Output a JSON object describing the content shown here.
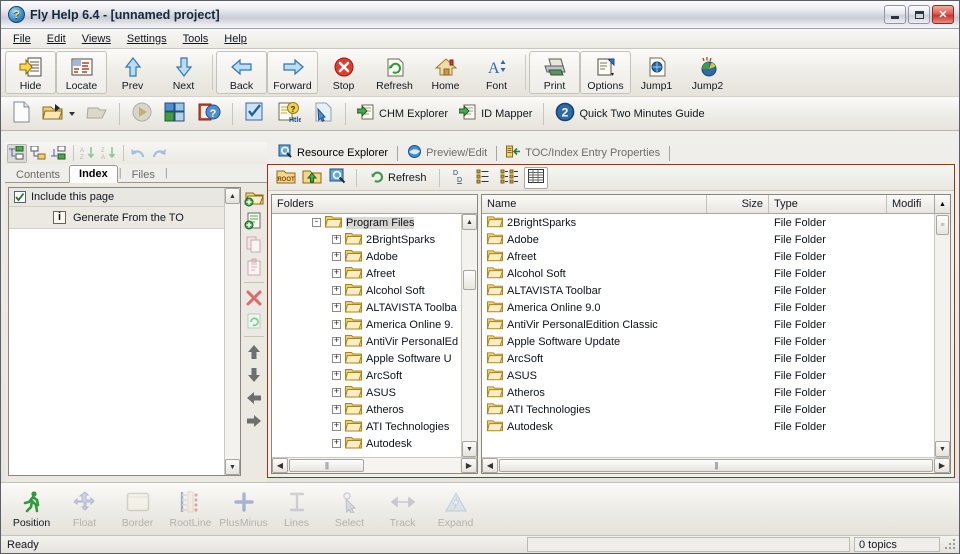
{
  "window": {
    "title": "Fly Help 6.4 - [unnamed project]",
    "icon": "help-question-icon",
    "buttons": {
      "minimize": "minimize-button",
      "maximize": "maximize-button",
      "close": "close-button"
    }
  },
  "menu": {
    "items": [
      "File",
      "Edit",
      "Views",
      "Settings",
      "Tools",
      "Help"
    ]
  },
  "toolbar_main": {
    "buttons": [
      {
        "label": "Hide",
        "icon": "hide-panel-icon",
        "framed": true
      },
      {
        "label": "Locate",
        "icon": "locate-icon",
        "framed": true
      },
      {
        "label": "Prev",
        "icon": "arrow-up-icon",
        "framed": false
      },
      {
        "label": "Next",
        "icon": "arrow-down-icon",
        "framed": false
      },
      {
        "label": "Back",
        "icon": "arrow-left-icon",
        "framed": true
      },
      {
        "label": "Forward",
        "icon": "arrow-right-icon",
        "framed": true
      },
      {
        "label": "Stop",
        "icon": "stop-icon",
        "framed": false
      },
      {
        "label": "Refresh",
        "icon": "refresh-icon",
        "framed": false
      },
      {
        "label": "Home",
        "icon": "home-icon",
        "framed": false
      },
      {
        "label": "Font",
        "icon": "font-size-icon",
        "framed": false
      },
      {
        "label": "Print",
        "icon": "printer-icon",
        "framed": true
      },
      {
        "label": "Options",
        "icon": "options-icon",
        "framed": true
      },
      {
        "label": "Jump1",
        "icon": "jump1-icon",
        "framed": false
      },
      {
        "label": "Jump2",
        "icon": "jump2-icon",
        "framed": false
      }
    ]
  },
  "toolbar_secondary": {
    "buttons": [
      {
        "label": "",
        "icon": "new-document-icon"
      },
      {
        "label": "",
        "icon": "open-folder-icon",
        "dropdown": true
      },
      {
        "label": "",
        "icon": "save-icon"
      },
      {
        "label": "",
        "icon": "compile-run-icon"
      },
      {
        "label": "",
        "icon": "layout-icon"
      },
      {
        "label": "",
        "icon": "chm-help-icon"
      },
      {
        "label": "",
        "icon": "checklist-icon"
      },
      {
        "label": "",
        "icon": "htlm-help-icon"
      },
      {
        "label": "",
        "icon": "page-pointer-icon"
      },
      {
        "label": "CHM Explorer",
        "icon": "chm-explorer-icon"
      },
      {
        "label": "ID Mapper",
        "icon": "id-mapper-icon"
      },
      {
        "label": "Quick Two Minutes Guide",
        "icon": "two-circle-icon"
      }
    ]
  },
  "left_panel": {
    "mini_toolbar": [
      {
        "icon": "add-sibling-icon",
        "active": true
      },
      {
        "icon": "add-child-icon",
        "active": false
      },
      {
        "icon": "add-item-icon",
        "active": false
      },
      {
        "icon": "sort-az-icon",
        "active": false
      },
      {
        "icon": "sort-za-icon",
        "active": false
      },
      {
        "icon": "undo-icon",
        "active": false
      },
      {
        "icon": "redo-icon",
        "active": false
      }
    ],
    "tabs": [
      {
        "label": "Contents",
        "active": false
      },
      {
        "label": "Index",
        "active": true
      },
      {
        "label": "Files",
        "active": false
      }
    ],
    "tab_divider": "|",
    "include_page": {
      "label": "Include this page",
      "checked": true,
      "icon": "checkbox-checked-icon"
    },
    "generate_row": {
      "label": "Generate From the TO",
      "icon": "info-icon"
    },
    "side_tools": [
      {
        "icon": "add-folder-icon"
      },
      {
        "icon": "add-page-icon"
      },
      {
        "icon": "copy-icon"
      },
      {
        "icon": "paste-icon"
      },
      {
        "icon": "delete-x-icon"
      },
      {
        "icon": "refresh-page-icon"
      },
      {
        "icon": "move-up-icon"
      },
      {
        "icon": "move-down-icon"
      },
      {
        "icon": "move-left-icon"
      },
      {
        "icon": "move-right-icon"
      }
    ]
  },
  "right_panel": {
    "tabs": [
      {
        "label": "Resource Explorer",
        "icon": "magnifier-icon",
        "active": true
      },
      {
        "label": "Preview/Edit",
        "icon": "browser-icon",
        "active": false
      },
      {
        "label": "TOC/Index Entry Properties",
        "icon": "toc-entry-icon",
        "active": false
      }
    ],
    "tab_divider": "|",
    "toolbar": [
      {
        "icon": "root-folder-icon",
        "label": ""
      },
      {
        "icon": "up-folder-icon",
        "label": ""
      },
      {
        "icon": "search-folder-icon",
        "label": ""
      },
      {
        "icon": "refresh-icon",
        "label": "Refresh"
      },
      {
        "icon": "view-details-small-icon",
        "label": ""
      },
      {
        "icon": "view-list-icon",
        "label": ""
      },
      {
        "icon": "view-columns-icon",
        "label": ""
      },
      {
        "icon": "view-details-icon",
        "label": "",
        "active": true
      }
    ],
    "tree": {
      "header": "Folders",
      "root": {
        "label": "Program Files",
        "expander": "-",
        "selected": true
      },
      "children": [
        {
          "label": "2BrightSparks",
          "expander": "+"
        },
        {
          "label": "Adobe",
          "expander": "+"
        },
        {
          "label": "Afreet",
          "expander": "+"
        },
        {
          "label": "Alcohol Soft",
          "expander": "+"
        },
        {
          "label": "ALTAVISTA Toolba",
          "expander": "+"
        },
        {
          "label": "America Online 9.",
          "expander": "+"
        },
        {
          "label": "AntiVir PersonalEd",
          "expander": "+"
        },
        {
          "label": "Apple Software U",
          "expander": "+"
        },
        {
          "label": "ArcSoft",
          "expander": "+"
        },
        {
          "label": "ASUS",
          "expander": "+"
        },
        {
          "label": "Atheros",
          "expander": "+"
        },
        {
          "label": "ATI Technologies",
          "expander": "+"
        },
        {
          "label": "Autodesk",
          "expander": "+"
        }
      ]
    },
    "list": {
      "columns": [
        "Name",
        "Size",
        "Type",
        "Modifi"
      ],
      "rows": [
        {
          "name": "2BrightSparks",
          "size": "",
          "type": "File Folder",
          "modified": ""
        },
        {
          "name": "Adobe",
          "size": "",
          "type": "File Folder",
          "modified": ""
        },
        {
          "name": "Afreet",
          "size": "",
          "type": "File Folder",
          "modified": ""
        },
        {
          "name": "Alcohol Soft",
          "size": "",
          "type": "File Folder",
          "modified": ""
        },
        {
          "name": "ALTAVISTA Toolbar",
          "size": "",
          "type": "File Folder",
          "modified": ""
        },
        {
          "name": "America Online 9.0",
          "size": "",
          "type": "File Folder",
          "modified": ""
        },
        {
          "name": "AntiVir PersonalEdition Classic",
          "size": "",
          "type": "File Folder",
          "modified": ""
        },
        {
          "name": "Apple Software Update",
          "size": "",
          "type": "File Folder",
          "modified": ""
        },
        {
          "name": "ArcSoft",
          "size": "",
          "type": "File Folder",
          "modified": ""
        },
        {
          "name": "ASUS",
          "size": "",
          "type": "File Folder",
          "modified": ""
        },
        {
          "name": "Atheros",
          "size": "",
          "type": "File Folder",
          "modified": ""
        },
        {
          "name": "ATI Technologies",
          "size": "",
          "type": "File Folder",
          "modified": ""
        },
        {
          "name": "Autodesk",
          "size": "",
          "type": "File Folder",
          "modified": ""
        }
      ]
    }
  },
  "bottom_toolbar": {
    "buttons": [
      {
        "label": "Position",
        "icon": "runner-icon",
        "enabled": true
      },
      {
        "label": "Float",
        "icon": "move-cross-icon",
        "enabled": false
      },
      {
        "label": "Border",
        "icon": "border-icon",
        "enabled": false
      },
      {
        "label": "RootLine",
        "icon": "rootline-icon",
        "enabled": false
      },
      {
        "label": "PlusMinus",
        "icon": "plus-icon",
        "enabled": false
      },
      {
        "label": "Lines",
        "icon": "i-beam-icon",
        "enabled": false
      },
      {
        "label": "Select",
        "icon": "cursor-icon",
        "enabled": false
      },
      {
        "label": "Track",
        "icon": "resize-h-icon",
        "enabled": false
      },
      {
        "label": "Expand",
        "icon": "expand-icon",
        "enabled": false
      }
    ]
  },
  "statusbar": {
    "ready": "Ready",
    "middle": "",
    "topics": "0 topics"
  },
  "colors": {
    "accent_border": "#8b3a14",
    "titlebar_text": "#16283c",
    "folder_yellow": "#f5c96a",
    "close_red": "#c8362b"
  }
}
